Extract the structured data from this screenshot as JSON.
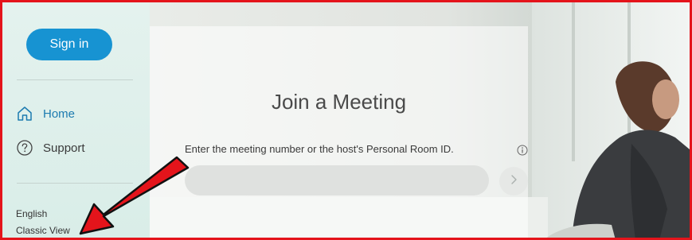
{
  "sidebar": {
    "signin_label": "Sign in",
    "nav": [
      {
        "label": "Home",
        "icon": "home-icon",
        "active": true
      },
      {
        "label": "Support",
        "icon": "help-icon",
        "active": false
      }
    ],
    "footer_links": [
      "English",
      "Classic View"
    ]
  },
  "main": {
    "title": "Join a Meeting",
    "hint": "Enter the meeting number or the host's Personal Room ID.",
    "input_value": "",
    "go_icon": "chevron-right-icon",
    "info_icon": "info-icon"
  },
  "annotation": {
    "frame_color": "#e4141b",
    "arrow_color": "#e4141b",
    "arrow_target": "Classic View"
  },
  "colors": {
    "accent": "#1793d2",
    "sidebar_bg": "#e4f2ee",
    "active_nav": "#1c7bb0"
  }
}
